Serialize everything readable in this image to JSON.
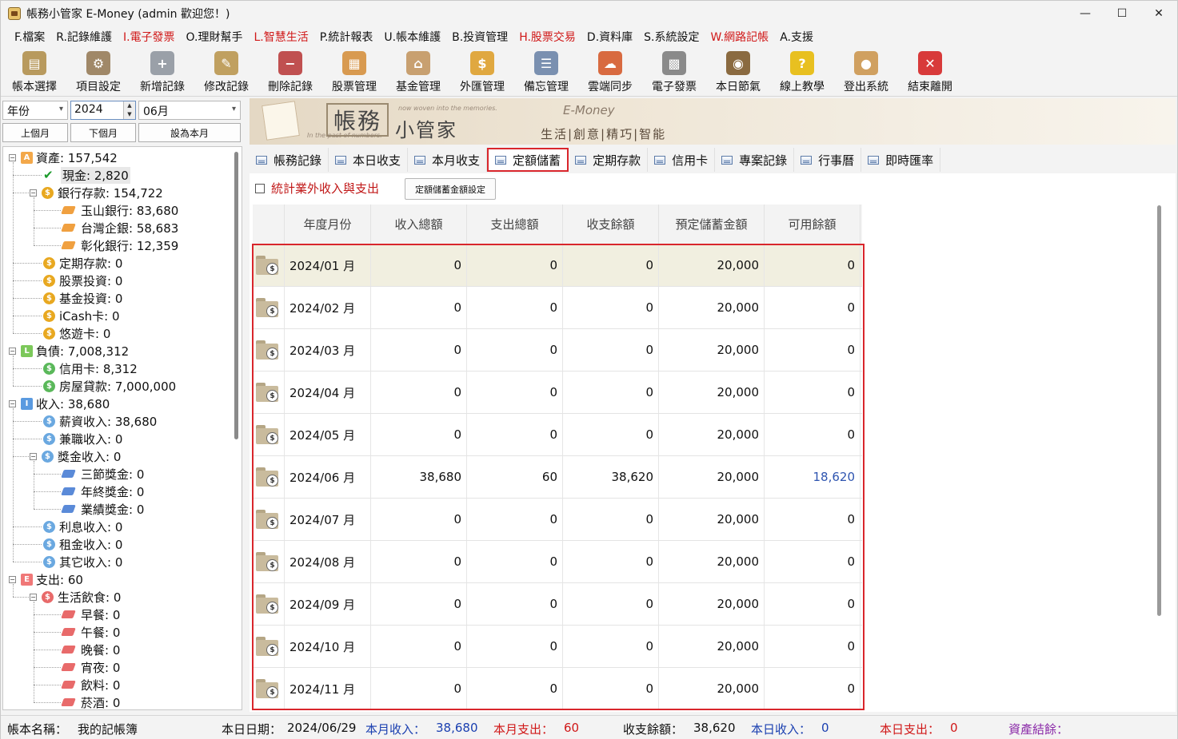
{
  "window": {
    "title": "帳務小管家 E-Money (admin 歡迎您！)",
    "min": "—",
    "max": "☐",
    "close": "✕"
  },
  "menu": [
    {
      "label": "F.檔案",
      "red": false
    },
    {
      "label": "R.記錄維護",
      "red": false
    },
    {
      "label": "I.電子發票",
      "red": true
    },
    {
      "label": "O.理財幫手",
      "red": false
    },
    {
      "label": "L.智慧生活",
      "red": true
    },
    {
      "label": "P.統計報表",
      "red": false
    },
    {
      "label": "U.帳本維護",
      "red": false
    },
    {
      "label": "B.投資管理",
      "red": false
    },
    {
      "label": "H.股票交易",
      "red": true
    },
    {
      "label": "D.資料庫",
      "red": false
    },
    {
      "label": "S.系統設定",
      "red": false
    },
    {
      "label": "W.網路記帳",
      "red": true
    },
    {
      "label": "A.支援",
      "red": false
    }
  ],
  "toolbar": [
    {
      "label": "帳本選擇",
      "icon": "ledger-book-icon",
      "color": "#b89a5e"
    },
    {
      "label": "項目設定",
      "icon": "gear-icon",
      "color": "#a08868"
    },
    {
      "label": "新增記錄",
      "icon": "add-document-icon",
      "color": "#9aa0a8"
    },
    {
      "label": "修改記錄",
      "icon": "edit-document-icon",
      "color": "#c0a060"
    },
    {
      "label": "刪除記錄",
      "icon": "delete-document-icon",
      "color": "#c05050"
    },
    {
      "label": "股票管理",
      "icon": "stock-icon",
      "color": "#d89a50"
    },
    {
      "label": "基金管理",
      "icon": "fund-icon",
      "color": "#c8a070"
    },
    {
      "label": "外匯管理",
      "icon": "forex-icon",
      "color": "#e0a840"
    },
    {
      "label": "備忘管理",
      "icon": "memo-icon",
      "color": "#7a90b0"
    },
    {
      "label": "雲端同步",
      "icon": "cloud-sync-icon",
      "color": "#d86a40"
    },
    {
      "label": "電子發票",
      "icon": "qr-code-icon",
      "color": "#8a8a8a"
    },
    {
      "label": "本日節氣",
      "icon": "solar-term-icon",
      "color": "#8a6a40"
    },
    {
      "label": "線上教學",
      "icon": "help-icon",
      "color": "#e8c020"
    },
    {
      "label": "登出系統",
      "icon": "logout-user-icon",
      "color": "#d0a060"
    },
    {
      "label": "結束離開",
      "icon": "exit-icon",
      "color": "#d83a3a"
    }
  ],
  "toolbar_glyphs": [
    "▤",
    "⚙",
    "+",
    "✎",
    "−",
    "▦",
    "⌂",
    "$",
    "☰",
    "☁",
    "▩",
    "◉",
    "?",
    "●",
    "✕"
  ],
  "period": {
    "type_selected": "年份",
    "year": "2024",
    "month_selected": "06月",
    "prev_month": "上個月",
    "next_month": "下個月",
    "this_month": "設為本月",
    "spin_up": "▲",
    "spin_down": "▼",
    "dropdown_arrow": "▾"
  },
  "tree": [
    {
      "level": 0,
      "label": "資產: 157,542",
      "kind": "sq",
      "mark": "A",
      "color": "#f3a84a",
      "expander": "−"
    },
    {
      "level": 1,
      "label": "現金: 2,820",
      "kind": "check",
      "mark": "✔",
      "color": "#1a9a2a",
      "selected": true
    },
    {
      "level": 1,
      "label": "銀行存款: 154,722",
      "kind": "coin",
      "mark": "$",
      "color": "#e8a820",
      "expander": "−"
    },
    {
      "level": 2,
      "label": "玉山銀行: 83,680",
      "kind": "tag",
      "mark": "",
      "color": "#f0a040"
    },
    {
      "level": 2,
      "label": "台灣企銀: 58,683",
      "kind": "tag",
      "mark": "",
      "color": "#f0a040"
    },
    {
      "level": 2,
      "label": "彰化銀行: 12,359",
      "kind": "tag",
      "mark": "",
      "color": "#f0a040"
    },
    {
      "level": 1,
      "label": "定期存款: 0",
      "kind": "coin",
      "mark": "$",
      "color": "#e8a820"
    },
    {
      "level": 1,
      "label": "股票投資: 0",
      "kind": "coin",
      "mark": "$",
      "color": "#e8a820"
    },
    {
      "level": 1,
      "label": "基金投資: 0",
      "kind": "coin",
      "mark": "$",
      "color": "#e8a820"
    },
    {
      "level": 1,
      "label": "iCash卡: 0",
      "kind": "coin",
      "mark": "$",
      "color": "#e8a820"
    },
    {
      "level": 1,
      "label": "悠遊卡: 0",
      "kind": "coin",
      "mark": "$",
      "color": "#e8a820"
    },
    {
      "level": 0,
      "label": "負債: 7,008,312",
      "kind": "sq",
      "mark": "L",
      "color": "#7cc85a",
      "expander": "−"
    },
    {
      "level": 1,
      "label": "信用卡: 8,312",
      "kind": "coin",
      "mark": "$",
      "color": "#5ab85a"
    },
    {
      "level": 1,
      "label": "房屋貸款: 7,000,000",
      "kind": "coin",
      "mark": "$",
      "color": "#5ab85a"
    },
    {
      "level": 0,
      "label": "收入: 38,680",
      "kind": "sq",
      "mark": "I",
      "color": "#5a9ae0",
      "expander": "−"
    },
    {
      "level": 1,
      "label": "薪資收入: 38,680",
      "kind": "coin",
      "mark": "$",
      "color": "#6aa8e0"
    },
    {
      "level": 1,
      "label": "兼職收入: 0",
      "kind": "coin",
      "mark": "$",
      "color": "#6aa8e0"
    },
    {
      "level": 1,
      "label": "獎金收入: 0",
      "kind": "coin",
      "mark": "$",
      "color": "#6aa8e0",
      "expander": "−"
    },
    {
      "level": 2,
      "label": "三節獎金: 0",
      "kind": "tag",
      "mark": "",
      "color": "#5a8ad8"
    },
    {
      "level": 2,
      "label": "年終獎金: 0",
      "kind": "tag",
      "mark": "",
      "color": "#5a8ad8"
    },
    {
      "level": 2,
      "label": "業績獎金: 0",
      "kind": "tag",
      "mark": "",
      "color": "#5a8ad8"
    },
    {
      "level": 1,
      "label": "利息收入: 0",
      "kind": "coin",
      "mark": "$",
      "color": "#6aa8e0"
    },
    {
      "level": 1,
      "label": "租金收入: 0",
      "kind": "coin",
      "mark": "$",
      "color": "#6aa8e0"
    },
    {
      "level": 1,
      "label": "其它收入: 0",
      "kind": "coin",
      "mark": "$",
      "color": "#6aa8e0"
    },
    {
      "level": 0,
      "label": "支出: 60",
      "kind": "sq",
      "mark": "E",
      "color": "#f07878",
      "expander": "−"
    },
    {
      "level": 1,
      "label": "生活飲食: 0",
      "kind": "coin",
      "mark": "$",
      "color": "#e86a6a",
      "expander": "−"
    },
    {
      "level": 2,
      "label": "早餐: 0",
      "kind": "tag",
      "mark": "",
      "color": "#e86a6a"
    },
    {
      "level": 2,
      "label": "午餐: 0",
      "kind": "tag",
      "mark": "",
      "color": "#e86a6a"
    },
    {
      "level": 2,
      "label": "晚餐: 0",
      "kind": "tag",
      "mark": "",
      "color": "#e86a6a"
    },
    {
      "level": 2,
      "label": "宵夜: 0",
      "kind": "tag",
      "mark": "",
      "color": "#e86a6a"
    },
    {
      "level": 2,
      "label": "飲料: 0",
      "kind": "tag",
      "mark": "",
      "color": "#e86a6a"
    },
    {
      "level": 2,
      "label": "菸酒: 0",
      "kind": "tag",
      "mark": "",
      "color": "#e86a6a"
    }
  ],
  "banner": {
    "title1": "帳務",
    "title2": "小管家",
    "sub1": "In the past of numbers.",
    "sub2": "now woven into the memories.",
    "brand": "E-Money",
    "slogan": "生活|創意|精巧|智能"
  },
  "tabs": [
    {
      "label": "帳務記錄",
      "active": false
    },
    {
      "label": "本日收支",
      "active": false
    },
    {
      "label": "本月收支",
      "active": false
    },
    {
      "label": "定額儲蓄",
      "active": true
    },
    {
      "label": "定期存款",
      "active": false
    },
    {
      "label": "信用卡",
      "active": false
    },
    {
      "label": "專案記錄",
      "active": false
    },
    {
      "label": "行事曆",
      "active": false
    },
    {
      "label": "即時匯率",
      "active": false
    }
  ],
  "savings": {
    "checkbox_label": "統計業外收入與支出",
    "checkbox_checked": false,
    "settings_button": "定額儲蓄金額設定",
    "row_icon_glyph": "$",
    "columns": [
      "年度月份",
      "收入總額",
      "支出總額",
      "收支餘額",
      "預定儲蓄金額",
      "可用餘額"
    ],
    "rows": [
      {
        "month": "2024/01 月",
        "income": "0",
        "expense": "0",
        "balance": "0",
        "target": "20,000",
        "available": "0"
      },
      {
        "month": "2024/02 月",
        "income": "0",
        "expense": "0",
        "balance": "0",
        "target": "20,000",
        "available": "0"
      },
      {
        "month": "2024/03 月",
        "income": "0",
        "expense": "0",
        "balance": "0",
        "target": "20,000",
        "available": "0"
      },
      {
        "month": "2024/04 月",
        "income": "0",
        "expense": "0",
        "balance": "0",
        "target": "20,000",
        "available": "0"
      },
      {
        "month": "2024/05 月",
        "income": "0",
        "expense": "0",
        "balance": "0",
        "target": "20,000",
        "available": "0"
      },
      {
        "month": "2024/06 月",
        "income": "38,680",
        "expense": "60",
        "balance": "38,620",
        "target": "20,000",
        "available": "18,620"
      },
      {
        "month": "2024/07 月",
        "income": "0",
        "expense": "0",
        "balance": "0",
        "target": "20,000",
        "available": "0"
      },
      {
        "month": "2024/08 月",
        "income": "0",
        "expense": "0",
        "balance": "0",
        "target": "20,000",
        "available": "0"
      },
      {
        "month": "2024/09 月",
        "income": "0",
        "expense": "0",
        "balance": "0",
        "target": "20,000",
        "available": "0"
      },
      {
        "month": "2024/10 月",
        "income": "0",
        "expense": "0",
        "balance": "0",
        "target": "20,000",
        "available": "0"
      },
      {
        "month": "2024/11 月",
        "income": "0",
        "expense": "0",
        "balance": "0",
        "target": "20,000",
        "available": "0"
      }
    ]
  },
  "status": {
    "ledger_label": "帳本名稱：",
    "ledger_value": "我的記帳簿",
    "today_label": "本日日期：",
    "today_value": "2024/06/29",
    "month_income_label": "本月收入：",
    "month_income_value": "38,680",
    "month_expense_label": "本月支出：",
    "month_expense_value": "60",
    "balance_label": "收支餘額：",
    "balance_value": "38,620",
    "day_income_label": "本日收入：",
    "day_income_value": "0",
    "day_expense_label": "本日支出：",
    "day_expense_value": "0",
    "asset_label": "資產結餘："
  },
  "colors": {
    "accent_red": "#d9262c",
    "link_blue": "#2f55b0",
    "selected_row": "#f1efe0"
  }
}
